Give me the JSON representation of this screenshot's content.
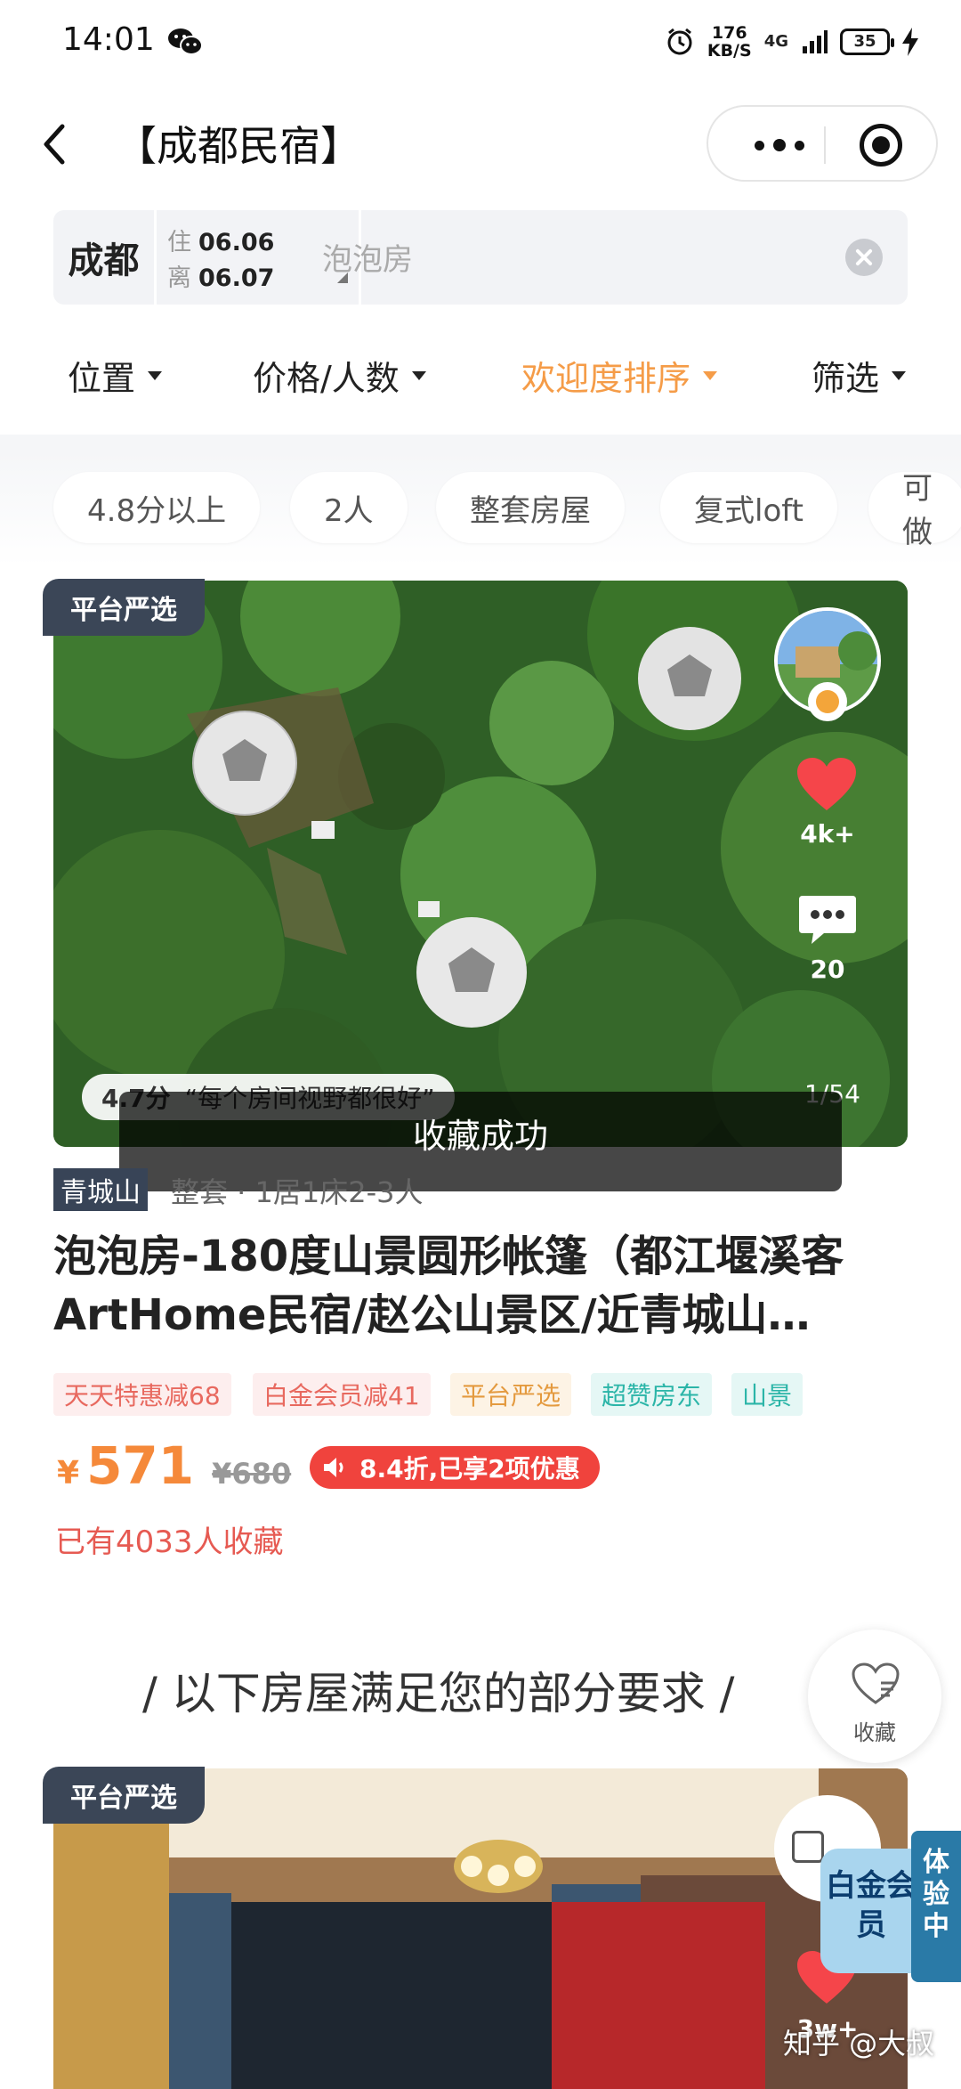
{
  "status_bar": {
    "time": "14:01",
    "speed_value": "176",
    "speed_unit": "KB/S",
    "network": "4G",
    "battery": "35",
    "icons": [
      "wechat-icon",
      "alarm-icon",
      "signal-icon",
      "battery-icon",
      "charging-icon"
    ]
  },
  "header": {
    "title": "【成都民宿】",
    "icons": [
      "back-icon",
      "more-icon",
      "target-icon"
    ]
  },
  "search": {
    "city": "成都",
    "checkin_label": "住",
    "checkin_date": "06.06",
    "checkout_label": "离",
    "checkout_date": "06.07",
    "query": "泡泡房"
  },
  "filters": [
    {
      "label": "位置",
      "active": false
    },
    {
      "label": "价格/人数",
      "active": false
    },
    {
      "label": "欢迎度排序",
      "active": true
    },
    {
      "label": "筛选",
      "active": false
    }
  ],
  "chips": [
    "4.8分以上",
    "2人",
    "整套房屋",
    "复式loft",
    "可做"
  ],
  "listing": {
    "badge": "平台严选",
    "likes": "4k+",
    "comments": "20",
    "rating": "4.7分",
    "review": "“每个房间视野都很好”",
    "photo_index": "1/54",
    "toast": "收藏成功",
    "location_tag": "青城山",
    "room_info": "整套 · 1居1床2-3人",
    "title": "泡泡房-180度山景圆形帐篷（都江堰溪客ArtHome民宿/赵公山景区/近青城山…",
    "tags": [
      {
        "text": "天天特惠减68",
        "color": "#e8695f",
        "bg": "#fdeeee"
      },
      {
        "text": "白金会员减41",
        "color": "#e8695f",
        "bg": "#fdeeee"
      },
      {
        "text": "平台严选",
        "color": "#e49a3f",
        "bg": "#fdf3e5"
      },
      {
        "text": "超赞房东",
        "color": "#2bb5a8",
        "bg": "#e5f7f5"
      },
      {
        "text": "山景",
        "color": "#2bb5a8",
        "bg": "#e5f7f5"
      }
    ],
    "currency": "¥",
    "price": "571",
    "original_price": "¥680",
    "discount": "8.4折,已享2项优惠",
    "favorites": "已有4033人收藏"
  },
  "section_heading": "/ 以下房屋满足您的部分要求 /",
  "fav_button": "收藏",
  "listing2": {
    "badge": "平台严选",
    "likes": "3w+"
  },
  "member_float": {
    "main": "白金会员",
    "side": "体验中"
  },
  "watermark": "知乎 @大叔",
  "colors": {
    "accent_orange": "#f59c48",
    "price_orange": "#f5893a",
    "discount_red": "#f0433d",
    "badge_navy": "#3b4657"
  }
}
